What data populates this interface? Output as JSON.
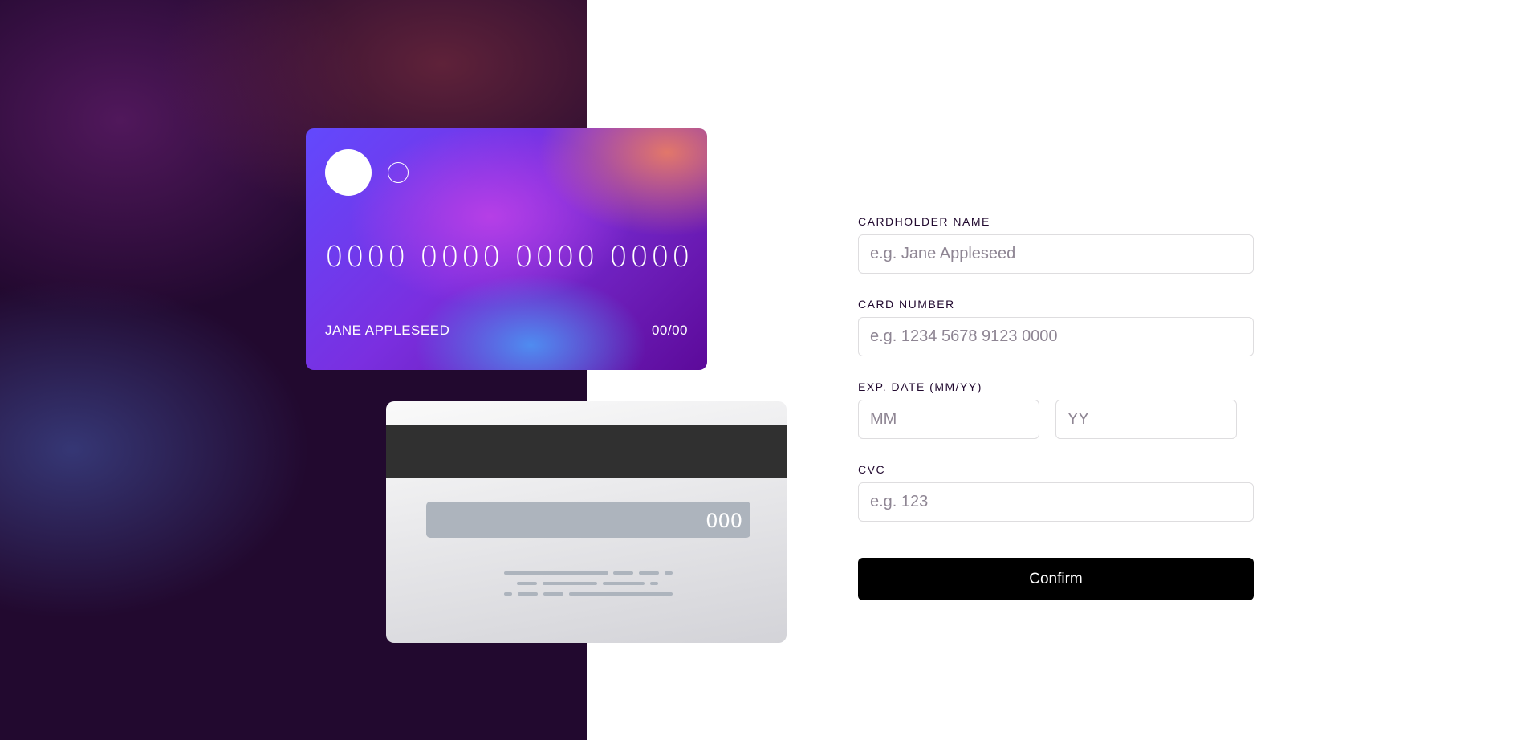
{
  "card_front": {
    "number": "0000 0000 0000 0000",
    "name": "JANE APPLESEED",
    "expiry": "00/00"
  },
  "card_back": {
    "cvc": "000"
  },
  "form": {
    "name_label": "CARDHOLDER NAME",
    "name_placeholder": "e.g. Jane Appleseed",
    "number_label": "CARD NUMBER",
    "number_placeholder": "e.g. 1234 5678 9123 0000",
    "exp_label": "EXP. DATE (MM/YY)",
    "mm_placeholder": "MM",
    "yy_placeholder": "YY",
    "cvc_label": "CVC",
    "cvc_placeholder": "e.g. 123",
    "confirm_label": "Confirm"
  }
}
